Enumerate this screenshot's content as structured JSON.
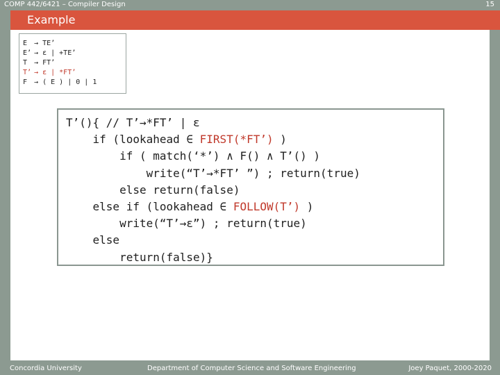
{
  "header": {
    "course": "COMP 442/6421 – Compiler Design",
    "page_number": "15"
  },
  "slide": {
    "title": "Example"
  },
  "grammar": {
    "rows": [
      {
        "lhs": "E",
        "arrow": "→",
        "rhs": "TE’",
        "red": false
      },
      {
        "lhs": "E’",
        "arrow": "→",
        "rhs": "ε | +TE’",
        "red": false
      },
      {
        "lhs": "T",
        "arrow": "→",
        "rhs": "FT’",
        "red": false
      },
      {
        "lhs": "T’",
        "arrow": "→",
        "rhs": "ε | *FT’",
        "red": true
      },
      {
        "lhs": "F",
        "arrow": "→",
        "rhs": "( E ) | 0 | 1",
        "red": false
      }
    ]
  },
  "code": {
    "lines": [
      [
        {
          "t": "T’(){ // T’"
        },
        {
          "t": "→*FT’ | ε"
        }
      ],
      [
        {
          "t": "    if (lookahead ∈ "
        },
        {
          "t": "FIRST(*FT’)",
          "c": "red"
        },
        {
          "t": " )"
        }
      ],
      [
        {
          "t": "        if ( match(‘*’) ∧ F() ∧ T’() )"
        }
      ],
      [
        {
          "t": "            write(“T’→*FT’ ”) ; return(true)"
        }
      ],
      [
        {
          "t": "        else return(false)"
        }
      ],
      [
        {
          "t": "    else if (lookahead ∈ "
        },
        {
          "t": "FOLLOW(T’)",
          "c": "red"
        },
        {
          "t": " )"
        }
      ],
      [
        {
          "t": "        write(“T’→ε”) ; return(true)"
        }
      ],
      [
        {
          "t": "    else"
        }
      ],
      [
        {
          "t": "        return(false)}"
        }
      ]
    ],
    "highlight_color": "#c0392b"
  },
  "footer": {
    "left": "Concordia University",
    "center": "Department of Computer Science and Software Engineering",
    "right": "Joey Paquet, 2000-2020"
  }
}
